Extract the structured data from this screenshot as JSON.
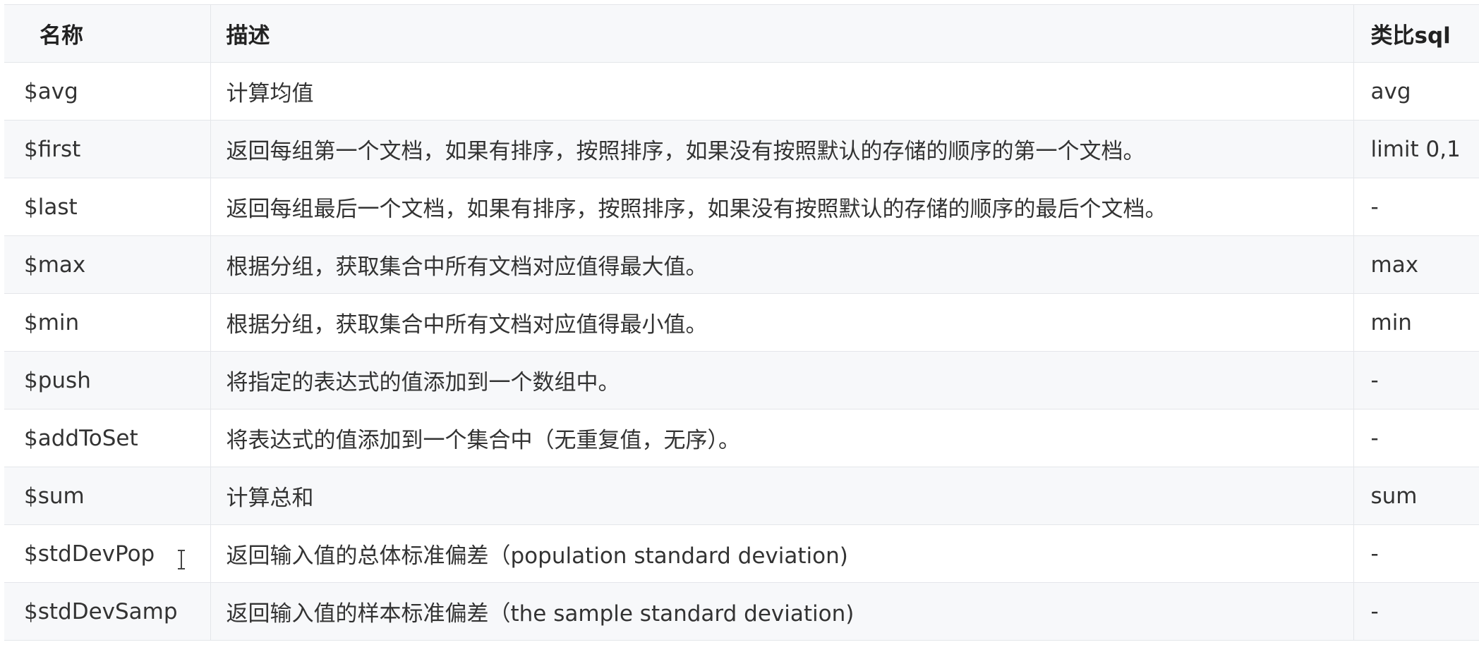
{
  "table": {
    "headers": {
      "name": "名称",
      "description": "描述",
      "sql": "类比sql"
    },
    "rows": [
      {
        "name": "$avg",
        "description": "计算均值",
        "sql": "avg"
      },
      {
        "name": "$first",
        "description": "返回每组第一个文档，如果有排序，按照排序，如果没有按照默认的存储的顺序的第一个文档。",
        "sql": "limit 0,1"
      },
      {
        "name": "$last",
        "description": "返回每组最后一个文档，如果有排序，按照排序，如果没有按照默认的存储的顺序的最后个文档。",
        "sql": "-"
      },
      {
        "name": "$max",
        "description": "根据分组，获取集合中所有文档对应值得最大值。",
        "sql": "max"
      },
      {
        "name": "$min",
        "description": "根据分组，获取集合中所有文档对应值得最小值。",
        "sql": "min"
      },
      {
        "name": "$push",
        "description": "将指定的表达式的值添加到一个数组中。",
        "sql": "-"
      },
      {
        "name": "$addToSet",
        "description": "将表达式的值添加到一个集合中（无重复值，无序）。",
        "sql": "-"
      },
      {
        "name": "$sum",
        "description": "计算总和",
        "sql": "sum"
      },
      {
        "name": "$stdDevPop",
        "description": "返回输入值的总体标准偏差（population standard deviation)",
        "sql": "-"
      },
      {
        "name": "$stdDevSamp",
        "description": "返回输入值的样本标准偏差（the sample standard deviation)",
        "sql": "-"
      }
    ]
  },
  "cursor": {
    "icon": "text-cursor-icon"
  }
}
